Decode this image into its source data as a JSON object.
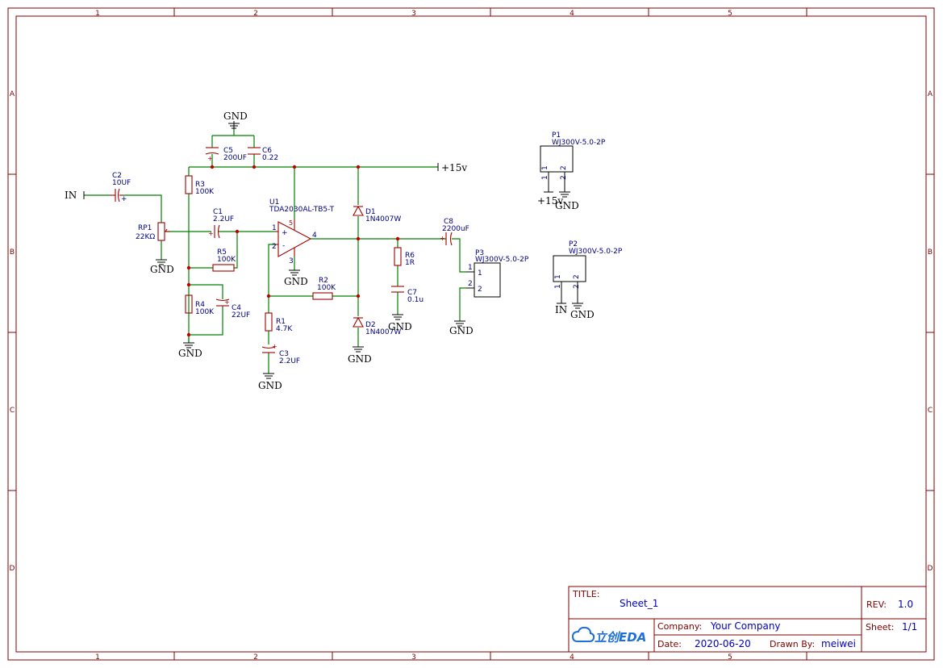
{
  "frame": {
    "columns": [
      "1",
      "2",
      "3",
      "4",
      "5"
    ],
    "rows": [
      "A",
      "B",
      "C",
      "D"
    ]
  },
  "title_block": {
    "title_label": "TITLE:",
    "title_value": "Sheet_1",
    "rev_label": "REV:",
    "rev_value": "1.0",
    "company_label": "Company:",
    "company_value": "Your Company",
    "sheet_label": "Sheet:",
    "sheet_value": "1/1",
    "date_label": "Date:",
    "date_value": "2020-06-20",
    "drawn_label": "Drawn By:",
    "drawn_value": "meiwei",
    "logo_text": "立创EDA"
  },
  "nets": {
    "gnd": "GND",
    "in": "IN",
    "v15": "+15v"
  },
  "components": {
    "c2": {
      "ref": "C2",
      "value": "10UF"
    },
    "rp1": {
      "ref": "RP1",
      "value": "22KΩ"
    },
    "r3": {
      "ref": "R3",
      "value": "100K"
    },
    "c5": {
      "ref": "C5",
      "value": "200UF"
    },
    "c6": {
      "ref": "C6",
      "value": "0.22"
    },
    "c1": {
      "ref": "C1",
      "value": "2.2UF"
    },
    "r5": {
      "ref": "R5",
      "value": "100K"
    },
    "r4": {
      "ref": "R4",
      "value": "100K"
    },
    "c4": {
      "ref": "C4",
      "value": "22UF"
    },
    "u1": {
      "ref": "U1",
      "value": "TDA2030AL-TB5-T"
    },
    "r1": {
      "ref": "R1",
      "value": "4.7K"
    },
    "c3": {
      "ref": "C3",
      "value": "2.2UF"
    },
    "r2": {
      "ref": "R2",
      "value": "100K"
    },
    "d1": {
      "ref": "D1",
      "value": "1N4007W"
    },
    "d2": {
      "ref": "D2",
      "value": "1N4007W"
    },
    "r6": {
      "ref": "R6",
      "value": "1R"
    },
    "c7": {
      "ref": "C7",
      "value": "0.1u"
    },
    "c8": {
      "ref": "C8",
      "value": "2200uF"
    },
    "p1": {
      "ref": "P1",
      "value": "WJ300V-5.0-2P"
    },
    "p2": {
      "ref": "P2",
      "value": "WJ300V-5.0-2P"
    },
    "p3": {
      "ref": "P3",
      "value": "WJ300V-5.0-2P"
    }
  },
  "pins": {
    "plus": "+",
    "minus": "-",
    "one": "1",
    "two": "2",
    "three": "3",
    "four": "4",
    "five": "5"
  }
}
